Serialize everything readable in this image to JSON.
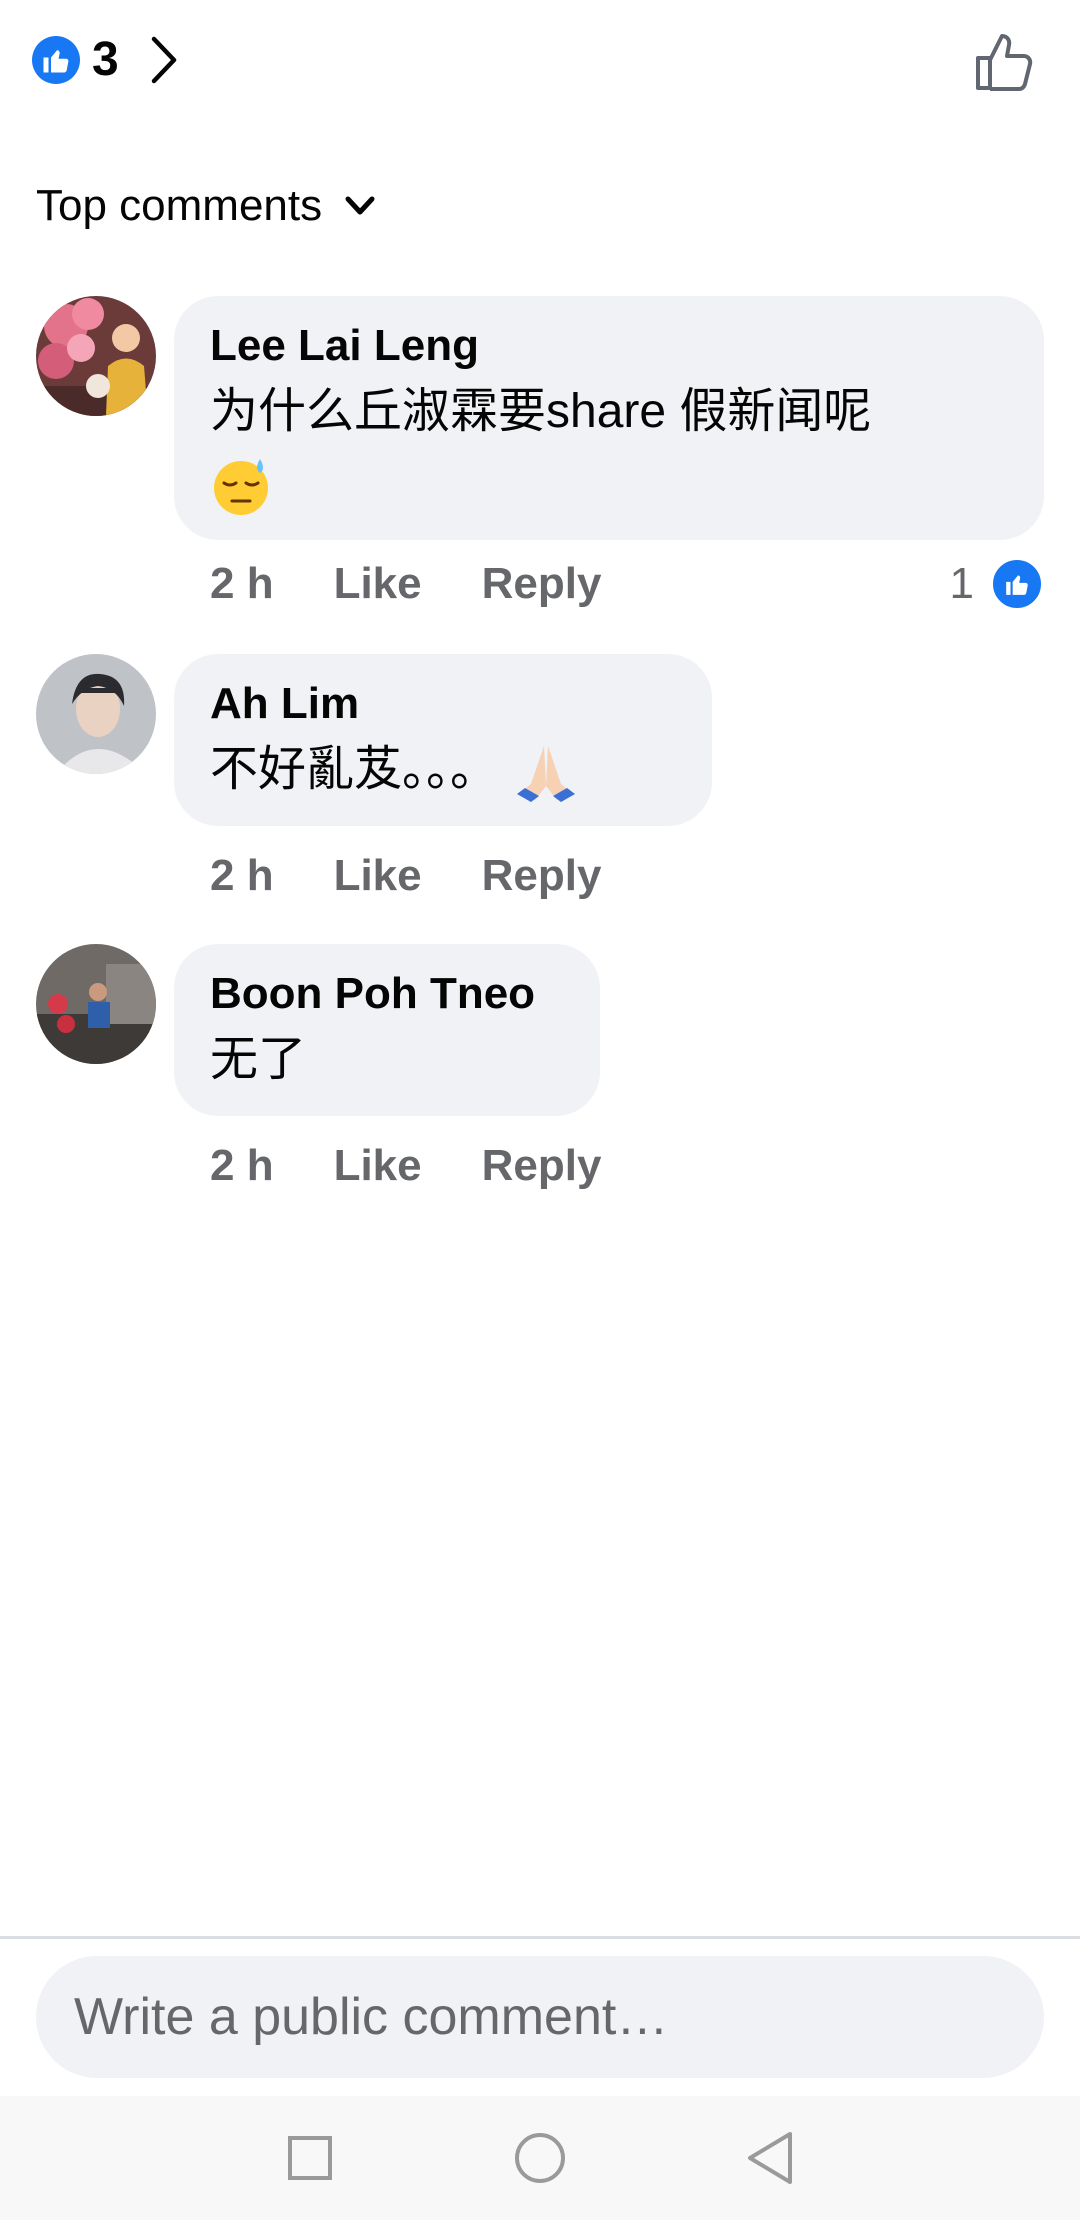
{
  "header": {
    "reaction_icon": "like-reaction-icon",
    "reaction_count": "3",
    "expand_icon": "chevron-right-icon",
    "like_button_icon": "thumbs-up-outline-icon"
  },
  "sort": {
    "label": "Top comments",
    "icon": "chevron-down-icon"
  },
  "comments": [
    {
      "author": "Lee Lai Leng",
      "text": "为什么丘淑霖要share 假新闻呢",
      "emoji": "downcast-face-with-sweat",
      "time": "2 h",
      "like_label": "Like",
      "reply_label": "Reply",
      "like_count": "1"
    },
    {
      "author": "Ah Lim",
      "text": "不好亂芨。。。",
      "emoji": "folded-hands",
      "time": "2 h",
      "like_label": "Like",
      "reply_label": "Reply"
    },
    {
      "author": "Boon Poh Tneo",
      "text": "无了",
      "time": "2 h",
      "like_label": "Like",
      "reply_label": "Reply"
    }
  ],
  "composer": {
    "placeholder": "Write a public comment…"
  },
  "navbar": {
    "items": [
      "recents-square-icon",
      "home-circle-icon",
      "back-triangle-icon"
    ]
  },
  "colors": {
    "accent": "#1877f2",
    "bubble": "#f0f2f5",
    "secondary_text": "#65676b",
    "primary_text": "#050505"
  }
}
